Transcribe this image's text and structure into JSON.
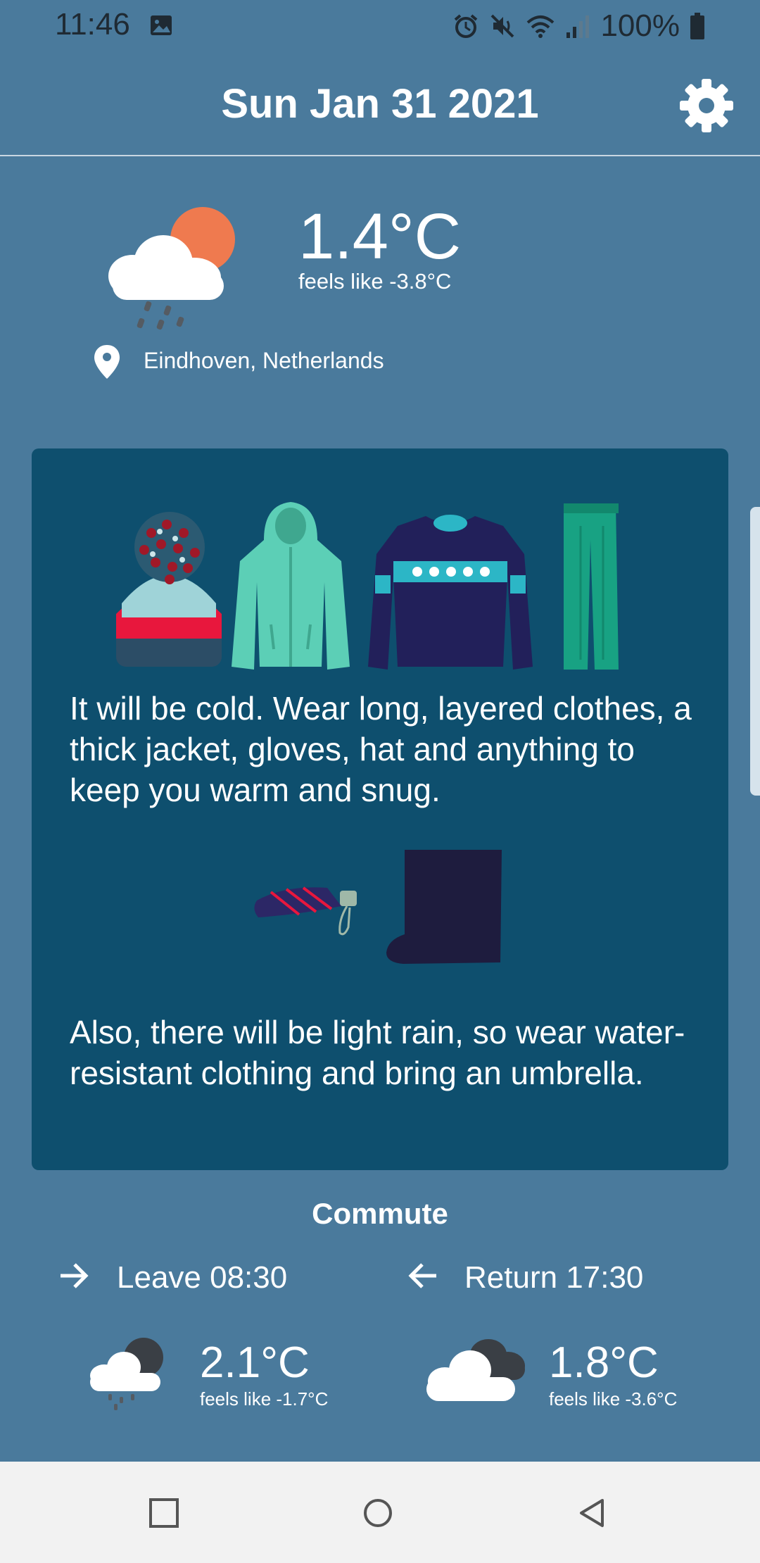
{
  "status_bar": {
    "time": "11:46",
    "battery": "100%",
    "icons": [
      "image-icon",
      "alarm-icon",
      "mute-icon",
      "wifi-icon",
      "signal-icon",
      "battery-icon"
    ]
  },
  "header": {
    "date": "Sun Jan 31 2021",
    "settings_icon": "gear-icon"
  },
  "current": {
    "temperature": "1.4°C",
    "feels_like": "feels like -3.8°C",
    "location": "Eindhoven, Netherlands",
    "icon": "cloud-sun-rain-icon"
  },
  "advice": {
    "clothes": [
      "winter-hat-icon",
      "jacket-icon",
      "sweater-icon",
      "trousers-icon"
    ],
    "text": "It will be cold. Wear long, layered clothes, a thick jacket, gloves, hat and anything to keep you warm and snug.",
    "rain_items": [
      "umbrella-icon",
      "rain-boot-icon"
    ],
    "rain_text": "Also, there will be light rain, so wear water-resistant clothing and bring an umbrella."
  },
  "commute": {
    "title": "Commute",
    "leave": {
      "label": "Leave 08:30",
      "temperature": "2.1°C",
      "feels_like": "feels like -1.7°C",
      "icon": "cloud-moon-rain-icon"
    },
    "return": {
      "label": "Return 17:30",
      "temperature": "1.8°C",
      "feels_like": "feels like -3.6°C",
      "icon": "clouds-icon"
    }
  },
  "colors": {
    "background": "#4a7a9c",
    "card": "#0e4f6e",
    "sun": "#ef7a4f",
    "nav_bar": "#f2f2f2"
  }
}
